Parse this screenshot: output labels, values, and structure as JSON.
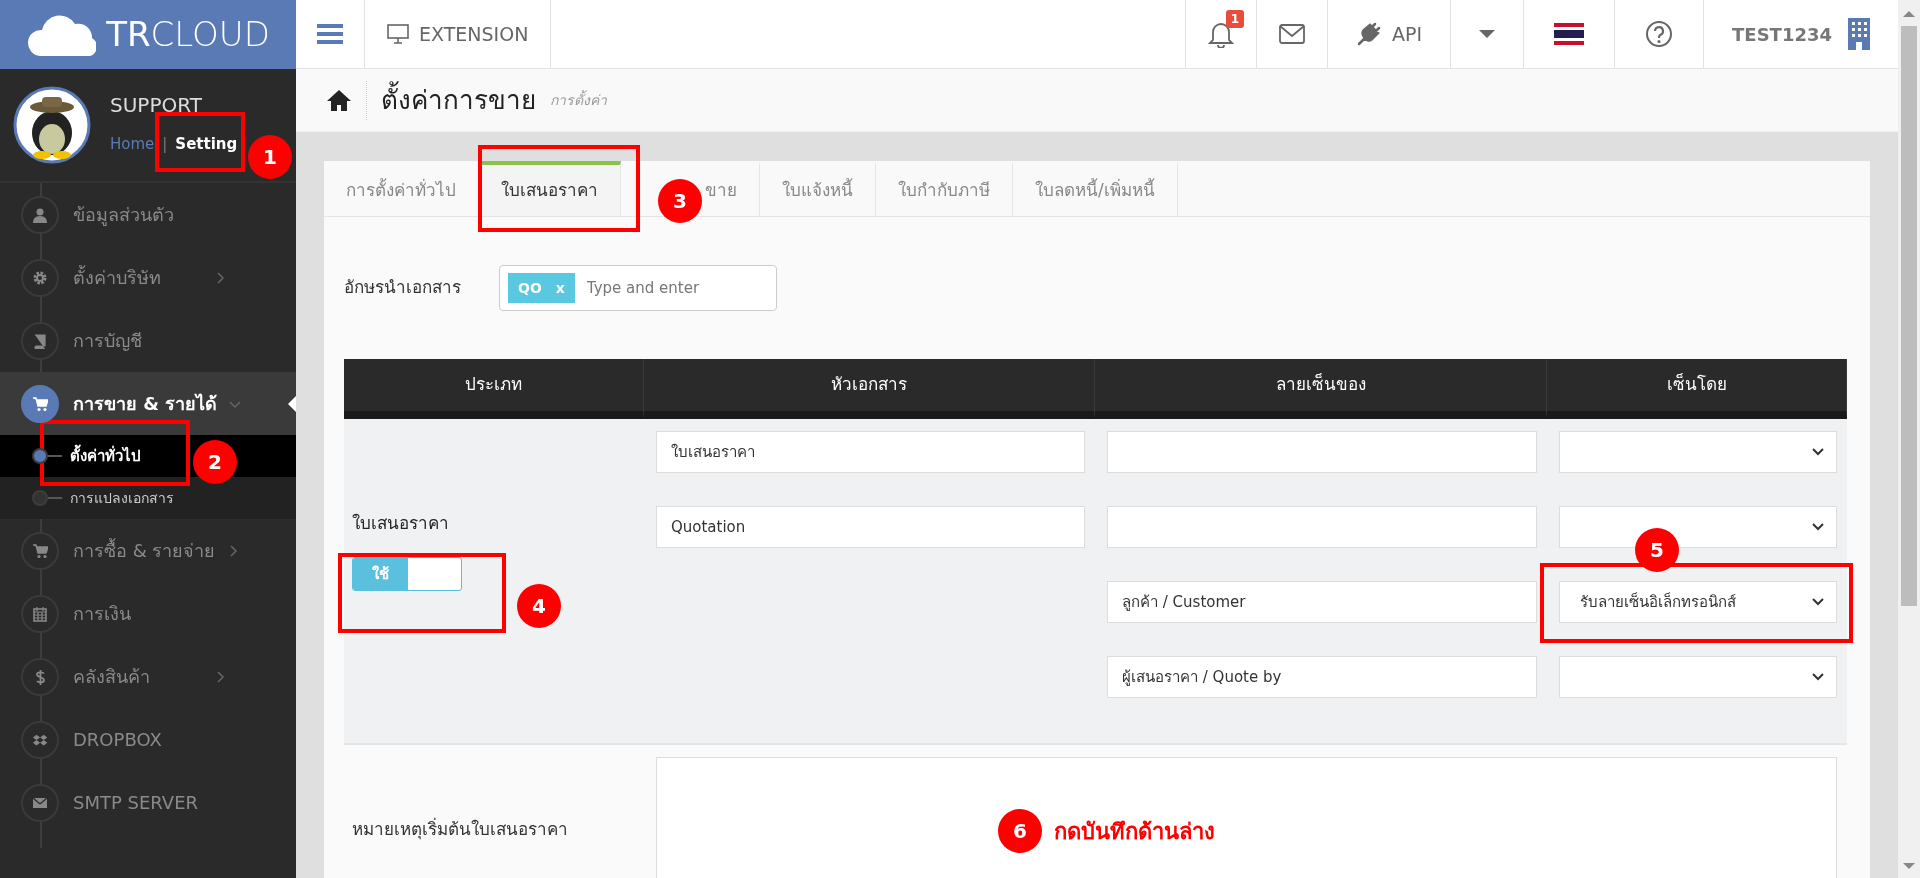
{
  "topbar": {
    "logo": "**TR**CLOUD",
    "extension": "EXTENSION",
    "notification_count": "1",
    "api": "API",
    "user": "TEST1234"
  },
  "sidebar": {
    "user": {
      "name": "SUPPORT",
      "links": [
        {
          "label": "Home",
          "selected": false
        },
        {
          "label": "Setting",
          "selected": true
        }
      ],
      "link_separator": "|"
    },
    "items": [
      {
        "label": "ข้อมูลส่วนตัว",
        "selected": false
      },
      {
        "label": "ตั้งค่าบริษัท",
        "expanded": false,
        "selected": false
      },
      {
        "label": "การบัญชี",
        "selected": false
      },
      {
        "label": "การขาย & รายได้",
        "expanded": true,
        "selected": true,
        "children": [
          {
            "label": "ตั้งค่าทั่วไป",
            "selected": true
          },
          {
            "label": "การแปลงเอกสาร",
            "selected": false
          }
        ]
      },
      {
        "label": "การซื้อ & รายจ่าย",
        "expanded": false,
        "selected": false
      },
      {
        "label": "การเงิน",
        "selected": false
      },
      {
        "label": "คลังสินค้า",
        "expanded": false,
        "selected": false
      },
      {
        "label": "DROPBOX",
        "selected": false
      },
      {
        "label": "SMTP SERVER",
        "selected": false
      }
    ]
  },
  "page_header": {
    "title": "ตั้งค่าการขาย",
    "subtitle": "การตั้งค่า"
  },
  "tabs": [
    {
      "label": "การตั้งค่าทั่วไป",
      "selected": false
    },
    {
      "label": "ใบเสนอราคา",
      "selected": true
    },
    {
      "label": "ขาย",
      "selected": false
    },
    {
      "label": "ใบแจ้งหนี้",
      "selected": false
    },
    {
      "label": "ใบกำกับภาษี",
      "selected": false
    },
    {
      "label": "ใบลดหนี้/เพิ่มหนี้",
      "selected": false
    }
  ],
  "prefix": {
    "label": "อักษรนำเอกสาร",
    "tags": [
      "QO"
    ],
    "tag_remove": "x",
    "placeholder": "Type and enter"
  },
  "table": {
    "columns": [
      "ประเภท",
      "หัวเอกสาร",
      "ลายเซ็นของ",
      "เซ็นโดย"
    ],
    "type_label": "ใบเสนอราคา",
    "toggle": {
      "label": "ใช้",
      "on": true
    },
    "header_fields": [
      "ใบเสนอราคา",
      "Quotation"
    ],
    "signatures": [
      {
        "kind": "blank"
      },
      {
        "kind": "blank"
      },
      {
        "kind": "labeled",
        "label": "ลูกค้า / Customer",
        "sign_by": "รับลายเซ็นอิเล็กทรอนิกส์"
      },
      {
        "kind": "labeled",
        "label": "ผู้เสนอราคา / Quote by"
      }
    ]
  },
  "note": {
    "label": "หมายเหตุเริ่มต้นใบเสนอราคา"
  },
  "annotations": [
    {
      "number": "1"
    },
    {
      "number": "2"
    },
    {
      "number": "3"
    },
    {
      "number": "4"
    },
    {
      "number": "5"
    },
    {
      "number": "6",
      "text": "กดบันทึกด้านล่าง"
    }
  ]
}
